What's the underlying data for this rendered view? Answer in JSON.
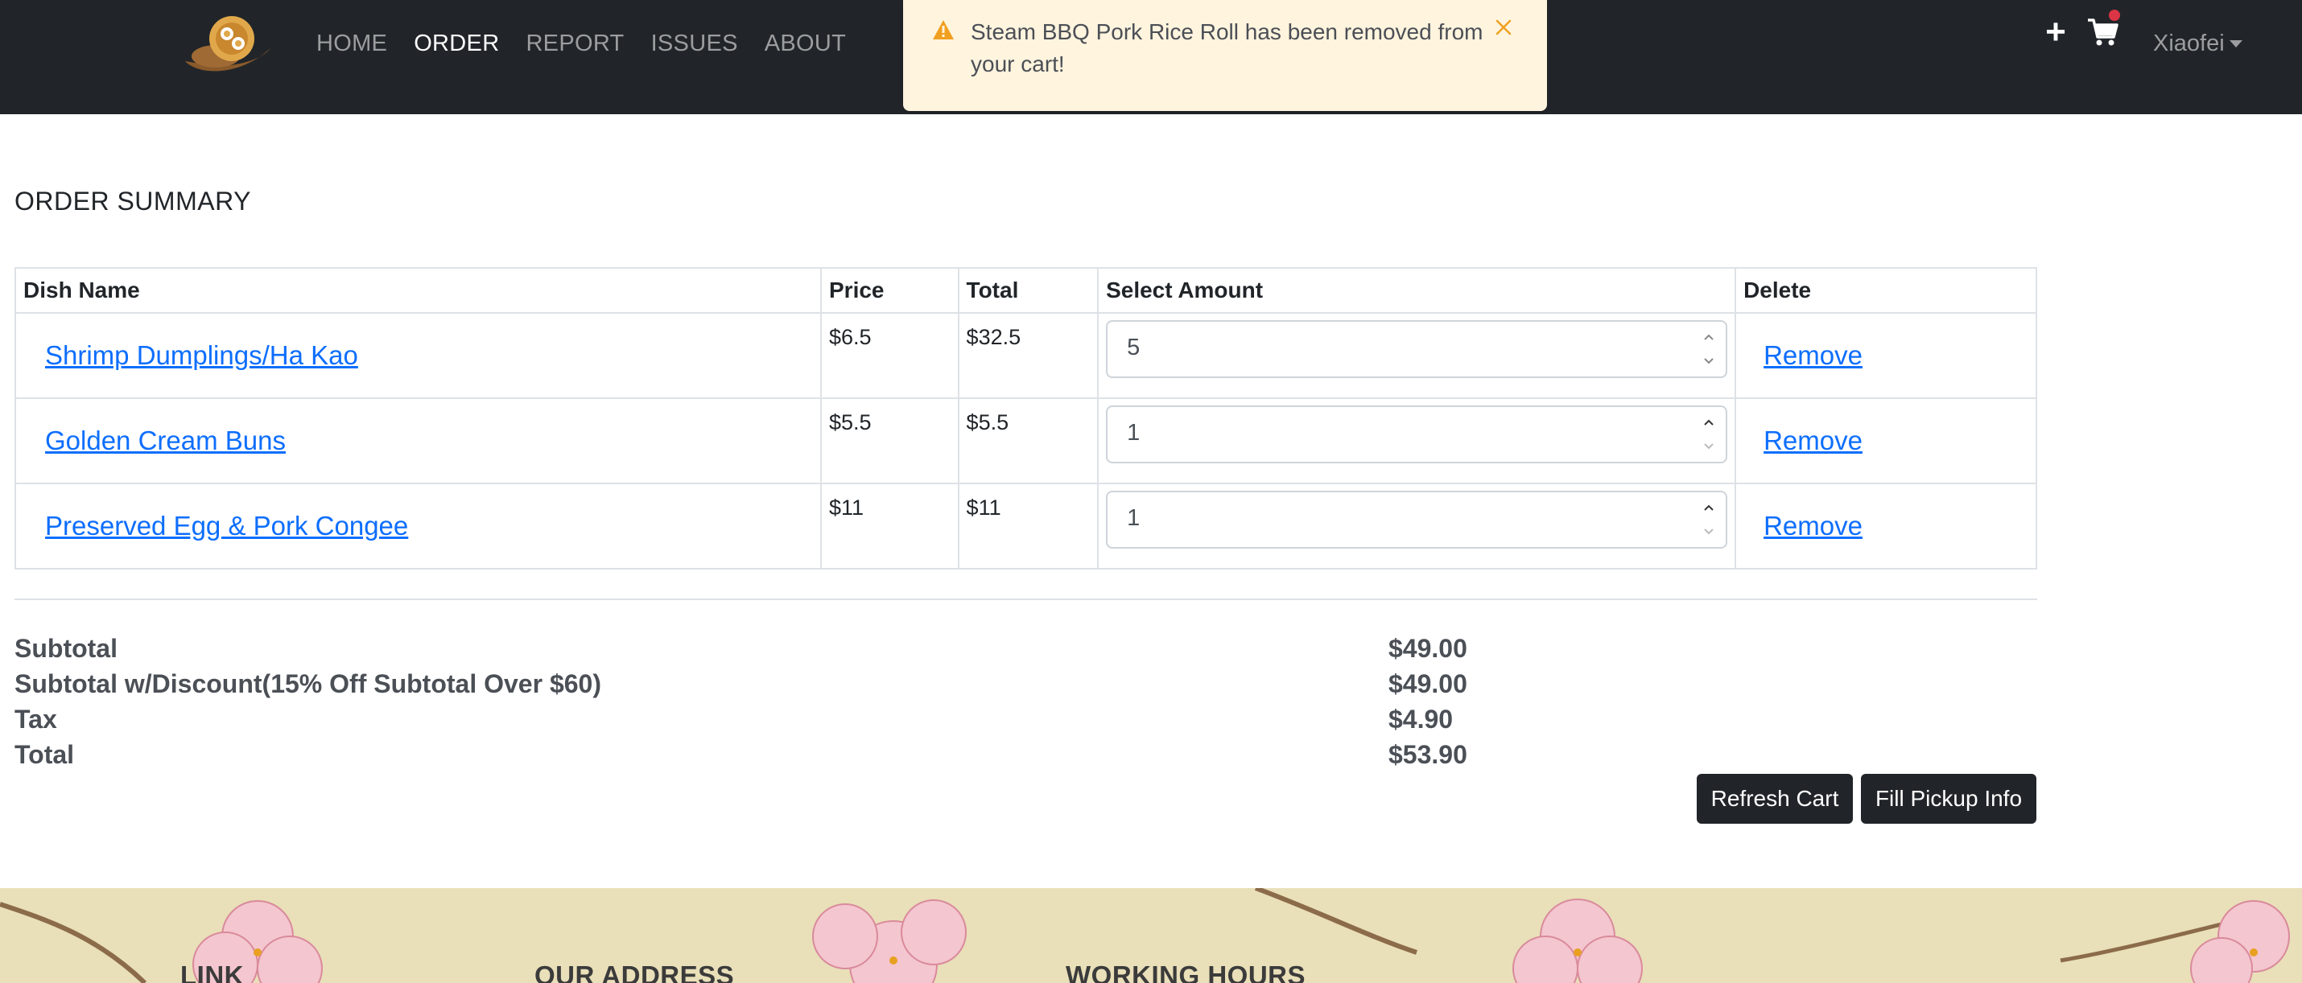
{
  "nav": {
    "logo_icon": "restaurant-logo",
    "links": [
      "HOME",
      "ORDER",
      "REPORT",
      "ISSUES",
      "ABOUT"
    ],
    "active": "ORDER",
    "user": "Xiaofei",
    "icons": [
      "plus-icon",
      "cart-icon"
    ]
  },
  "toast": {
    "icon": "warning-icon",
    "message": "Steam BBQ Pork Rice Roll has been removed from your cart!",
    "close_icon": "close-icon"
  },
  "page": {
    "title": "ORDER SUMMARY"
  },
  "table": {
    "headers": [
      "Dish Name",
      "Price",
      "Total",
      "Select Amount",
      "Delete"
    ],
    "rows": [
      {
        "dish": "Shrimp Dumplings/Ha Kao",
        "price": "$6.5",
        "total": "$32.5",
        "amount": "5",
        "action": "Remove"
      },
      {
        "dish": "Golden Cream Buns",
        "price": "$5.5",
        "total": "$5.5",
        "amount": "1",
        "action": "Remove"
      },
      {
        "dish": "Preserved Egg & Pork Congee",
        "price": "$11",
        "total": "$11",
        "amount": "1",
        "action": "Remove"
      }
    ]
  },
  "summary": {
    "subtotal_label": "Subtotal",
    "subtotal": "$49.00",
    "discount_label": "Subtotal w/Discount(15% Off Subtotal Over $60)",
    "discount": "$49.00",
    "tax_label": "Tax",
    "tax": "$4.90",
    "total_label": "Total",
    "total": "$53.90"
  },
  "buttons": {
    "refresh": "Refresh Cart",
    "pickup": "Fill Pickup Info"
  },
  "footer": {
    "headings": [
      "LINK",
      "OUR ADDRESS",
      "WORKING HOURS"
    ]
  },
  "colors": {
    "navbar": "#212529",
    "link": "#0d6efd",
    "toast_bg": "#fff4de",
    "warning": "#f0a020",
    "footer_bg": "#e9dfb9"
  }
}
